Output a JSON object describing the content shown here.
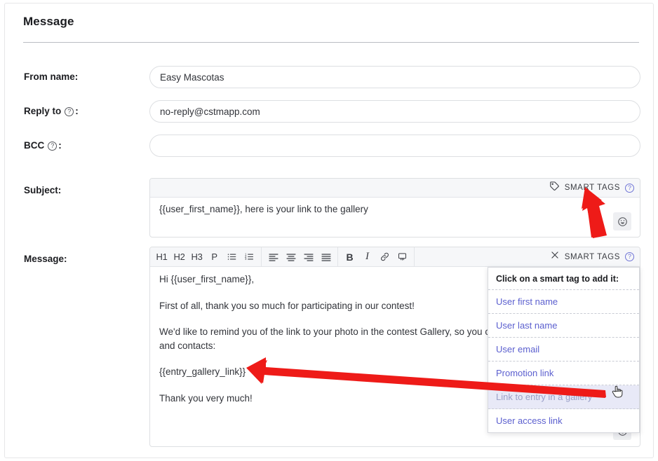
{
  "panel": {
    "title": "Message"
  },
  "fields": {
    "from_name": {
      "label": "From name:",
      "value": "Easy Mascotas",
      "placeholder": ""
    },
    "reply_to": {
      "label": "Reply to",
      "suffix": ":",
      "help_icon": "help-circle-icon",
      "value": "no-reply@cstmapp.com",
      "placeholder": ""
    },
    "bcc": {
      "label": "BCC",
      "suffix": ":",
      "help_icon": "help-circle-icon",
      "value": "",
      "placeholder": ""
    },
    "subject": {
      "label": "Subject:",
      "value": "{{user_first_name}}, here is your link to the gallery"
    },
    "message": {
      "label": "Message:",
      "paragraphs": [
        "Hi {{user_first_name}},",
        "First of all, thank you so much for participating in our contest!",
        "We'd like to remind you of the link to your photo in the contest Gallery, so you c",
        "and contacts:",
        "{{entry_gallery_link}}",
        "Thank you very much!"
      ]
    }
  },
  "subject_toolbar": {
    "tag_icon": "tag-icon",
    "smart_tags_label": "SMART TAGS",
    "help_icon": "help-circle-icon",
    "emoji_button_icon": "smiley-icon"
  },
  "message_toolbar": {
    "buttons": [
      {
        "name": "heading-1-button",
        "label": "H1"
      },
      {
        "name": "heading-2-button",
        "label": "H2"
      },
      {
        "name": "heading-3-button",
        "label": "H3"
      },
      {
        "name": "paragraph-button",
        "label": "P"
      },
      {
        "name": "bullet-list-button",
        "label": "bullet-list-icon"
      },
      {
        "name": "numbered-list-button",
        "label": "numbered-list-icon"
      },
      {
        "name": "align-left-button",
        "label": "align-left-icon"
      },
      {
        "name": "align-center-button",
        "label": "align-center-icon"
      },
      {
        "name": "align-right-button",
        "label": "align-right-icon"
      },
      {
        "name": "align-justify-button",
        "label": "align-justify-icon"
      },
      {
        "name": "bold-button",
        "label": "B"
      },
      {
        "name": "italic-button",
        "label": "I"
      },
      {
        "name": "link-button",
        "label": "link-icon"
      },
      {
        "name": "unlink-button",
        "label": "unlink-icon"
      }
    ],
    "close_icon": "close-x-icon",
    "smart_tags_label": "SMART TAGS",
    "help_icon": "help-circle-icon",
    "emoji_button_icon": "smiley-icon"
  },
  "smart_tags_dropdown": {
    "heading": "Click on a smart tag to add it:",
    "items": [
      {
        "label": "User first name",
        "active": false
      },
      {
        "label": "User last name",
        "active": false
      },
      {
        "label": "User email",
        "active": false
      },
      {
        "label": "Promotion link",
        "active": false
      },
      {
        "label": "Link to entry in a gallery",
        "active": true
      },
      {
        "label": "User access link",
        "active": false
      }
    ],
    "cursor_icon": "pointing-hand-cursor"
  },
  "annotations": {
    "arrow_color": "#ee1b18",
    "arrows": [
      {
        "name": "arrow-to-message-smart-tags",
        "direction": "down"
      },
      {
        "name": "arrow-to-entry-gallery-link",
        "direction": "left"
      }
    ]
  },
  "colors": {
    "link": "#5b5fcf",
    "link_active": "#9aa0c9",
    "active_row_bg": "#e8e9f7",
    "border": "#dddfe2",
    "toolbar_bg": "#f6f7f9",
    "text": "#32343a",
    "accent_help": "#6f74d6"
  }
}
